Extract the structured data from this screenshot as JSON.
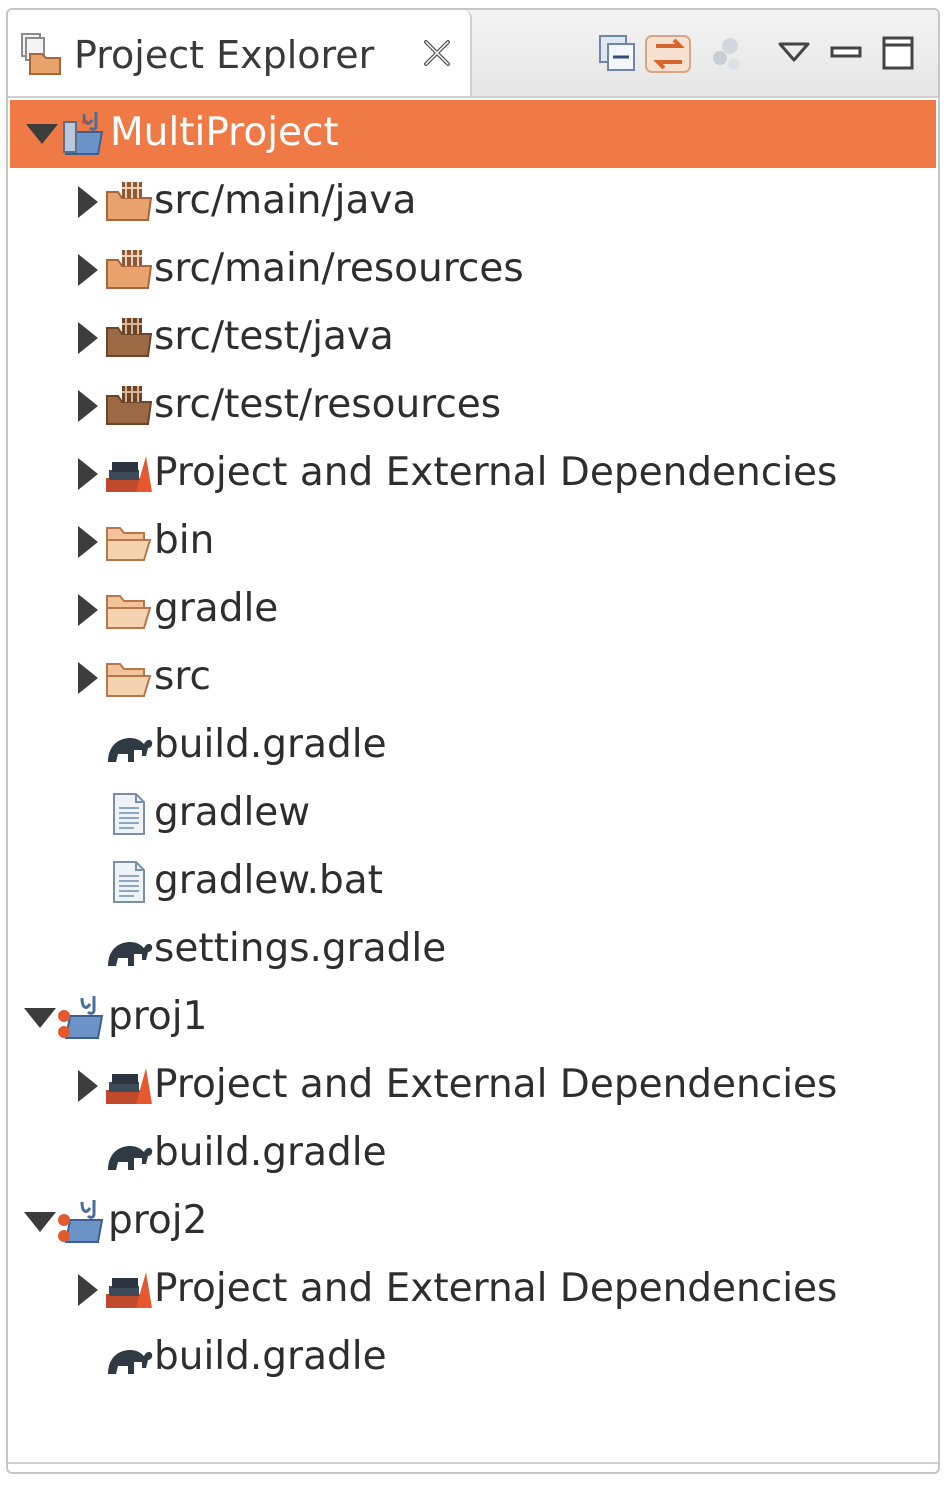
{
  "view": {
    "tab_title": "Project Explorer"
  },
  "colors": {
    "selection": "#ef7a45",
    "folder": "#e8a36d",
    "text": "#2e2e2e"
  },
  "icons": {
    "view": "project-explorer-icon",
    "close": "close-icon",
    "collapse_all": "collapse-all-icon",
    "link_with_editor": "link-with-editor-icon",
    "focus": "focus-icon",
    "view_menu": "view-menu-icon",
    "minimize": "minimize-icon",
    "maximize": "maximize-icon"
  },
  "tree": {
    "multiproject": {
      "label": "MultiProject",
      "children": [
        {
          "label": "src/main/java",
          "icon": "source-folder-icon"
        },
        {
          "label": "src/main/resources",
          "icon": "source-folder-icon"
        },
        {
          "label": "src/test/java",
          "icon": "source-folder-icon"
        },
        {
          "label": "src/test/resources",
          "icon": "source-folder-icon"
        },
        {
          "label": "Project and External Dependencies",
          "icon": "library-icon"
        },
        {
          "label": "bin",
          "icon": "folder-icon"
        },
        {
          "label": "gradle",
          "icon": "folder-icon"
        },
        {
          "label": "src",
          "icon": "folder-icon"
        },
        {
          "label": "build.gradle",
          "icon": "gradle-file-icon"
        },
        {
          "label": "gradlew",
          "icon": "text-file-icon"
        },
        {
          "label": "gradlew.bat",
          "icon": "text-file-icon"
        },
        {
          "label": "settings.gradle",
          "icon": "gradle-file-icon"
        }
      ]
    },
    "proj1": {
      "label": "proj1",
      "children": [
        {
          "label": "Project and External Dependencies",
          "icon": "library-icon"
        },
        {
          "label": "build.gradle",
          "icon": "gradle-file-icon"
        }
      ]
    },
    "proj2": {
      "label": "proj2",
      "children": [
        {
          "label": "Project and External Dependencies",
          "icon": "library-icon"
        },
        {
          "label": "build.gradle",
          "icon": "gradle-file-icon"
        }
      ]
    }
  }
}
